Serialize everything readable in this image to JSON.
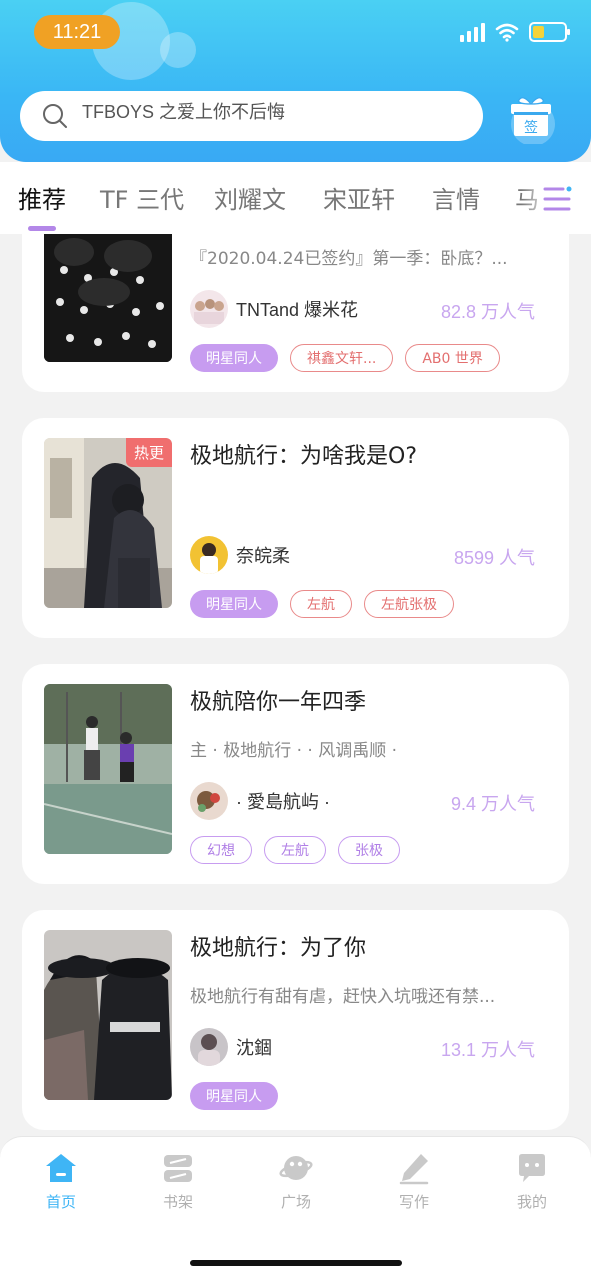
{
  "status_bar": {
    "time": "11:21"
  },
  "search": {
    "query": "TFBOYS 之爱上你不后悔"
  },
  "signin": {
    "label": "签"
  },
  "tabs": [
    {
      "label": "推荐"
    },
    {
      "label": "TF 三代"
    },
    {
      "label": "刘耀文"
    },
    {
      "label": "宋亚轩"
    },
    {
      "label": "言情"
    },
    {
      "label": "马"
    }
  ],
  "cards": [
    {
      "title": "",
      "description": "『2020.04.24已签约』第一季：卧底？...",
      "author": "TNTand 爆米花",
      "popularity": "82.8 万人气",
      "tags": [
        "明星同人",
        "祺鑫文轩...",
        "AB0 世界"
      ]
    },
    {
      "title": "极地航行：为啥我是O?",
      "badge": "热更",
      "description": "",
      "author": "奈皖柔",
      "popularity": "8599 人气",
      "tags": [
        "明星同人",
        "左航",
        "左航张极"
      ]
    },
    {
      "title": "极航陪你一年四季",
      "description": "主 · 极地航行 · · 风调禹顺 ·",
      "author": "· 愛島航屿 ·",
      "popularity": "9.4 万人气",
      "tags": [
        "幻想",
        "左航",
        "张极"
      ]
    },
    {
      "title": "极地航行：为了你",
      "description": "极地航行有甜有虐，赶快入坑哦还有禁...",
      "author": "沈錮",
      "popularity": "13.1 万人气",
      "tags": [
        "明星同人"
      ]
    }
  ],
  "bottom_nav": [
    {
      "label": "首页",
      "icon": "home-icon"
    },
    {
      "label": "书架",
      "icon": "bookshelf-icon"
    },
    {
      "label": "广场",
      "icon": "planet-icon"
    },
    {
      "label": "写作",
      "icon": "pen-icon"
    },
    {
      "label": "我的",
      "icon": "chat-bubble-icon"
    }
  ],
  "colors": {
    "header": "#3ab6f5",
    "accent": "#c79cf0",
    "active_nav": "#3fb5f5",
    "time_pill": "#f0a124"
  }
}
